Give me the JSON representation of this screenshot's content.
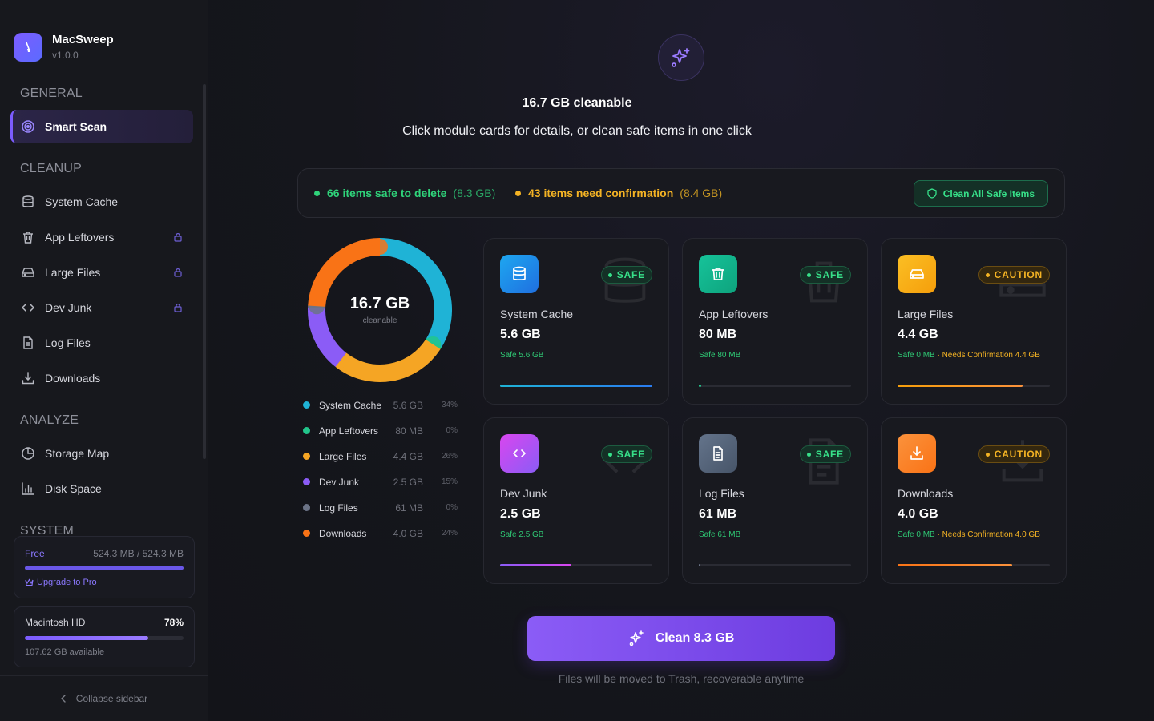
{
  "app": {
    "name": "MacSweep",
    "version": "v1.0.0",
    "accent": "#7c5cff"
  },
  "sidebar": {
    "sections": [
      {
        "label": "GENERAL"
      },
      {
        "label": "CLEANUP"
      },
      {
        "label": "ANALYZE"
      },
      {
        "label": "SYSTEM"
      }
    ],
    "items": [
      {
        "label": "Smart Scan",
        "icon": "radar-icon",
        "active": true,
        "locked": false
      },
      {
        "label": "System Cache",
        "icon": "database-icon",
        "active": false,
        "locked": false
      },
      {
        "label": "App Leftovers",
        "icon": "trash-icon",
        "active": false,
        "locked": true
      },
      {
        "label": "Large Files",
        "icon": "hard-drive-icon",
        "active": false,
        "locked": true
      },
      {
        "label": "Dev Junk",
        "icon": "code-icon",
        "active": false,
        "locked": true
      },
      {
        "label": "Log Files",
        "icon": "file-text-icon",
        "active": false,
        "locked": false
      },
      {
        "label": "Downloads",
        "icon": "download-icon",
        "active": false,
        "locked": false
      },
      {
        "label": "Storage Map",
        "icon": "pie-chart-icon",
        "active": false,
        "locked": false
      },
      {
        "label": "Disk Space",
        "icon": "bar-chart-icon",
        "active": false,
        "locked": false
      }
    ],
    "plan": {
      "label": "Free",
      "usage": "524.3 MB / 524.3 MB",
      "fill": 1.0,
      "upgrade": "Upgrade to Pro"
    },
    "disk": {
      "name": "Macintosh HD",
      "percent": "78%",
      "fill": 0.78,
      "available": "107.62 GB available"
    },
    "collapse": "Collapse sidebar"
  },
  "hero": {
    "title": "16.7 GB  cleanable",
    "subtitle": "Click module cards for details, or clean safe items in one click"
  },
  "summary": {
    "safe": {
      "text": "66 items safe to delete",
      "size": "(8.3 GB)",
      "color": "#2fd37a"
    },
    "warn": {
      "text": "43 items need confirmation",
      "size": "(8.4 GB)",
      "color": "#f4b324"
    },
    "button": "Clean All Safe Items"
  },
  "donut": {
    "value": "16.7 GB",
    "label": "cleanable"
  },
  "legend": [
    {
      "name": "System Cache",
      "size": "5.6 GB",
      "pct": "34%",
      "color": "#1fb3d6"
    },
    {
      "name": "App Leftovers",
      "size": "80 MB",
      "pct": "0%",
      "color": "#22c58b"
    },
    {
      "name": "Large Files",
      "size": "4.4 GB",
      "pct": "26%",
      "color": "#f5a524"
    },
    {
      "name": "Dev Junk",
      "size": "2.5 GB",
      "pct": "15%",
      "color": "#8b5cf6"
    },
    {
      "name": "Log Files",
      "size": "61 MB",
      "pct": "0%",
      "color": "#6b7386"
    },
    {
      "name": "Downloads",
      "size": "4.0 GB",
      "pct": "24%",
      "color": "#f97316"
    }
  ],
  "cards": [
    {
      "name": "System Cache",
      "size": "5.6 GB",
      "badge": "SAFE",
      "status": "safe",
      "icon": "database-icon",
      "grad": [
        "#1ea7f0",
        "#1f6fe0"
      ],
      "note_safe": "Safe 5.6 GB",
      "note_warn": "",
      "progress": 1.0,
      "bar": "linear-gradient(90deg,#1fb3d6,#2a7bf0)"
    },
    {
      "name": "App Leftovers",
      "size": "80 MB",
      "badge": "SAFE",
      "status": "safe",
      "icon": "trash-icon",
      "grad": [
        "#16c39a",
        "#0ea37d"
      ],
      "note_safe": "Safe 80 MB",
      "note_warn": "",
      "progress": 0.015,
      "bar": "#22c58b"
    },
    {
      "name": "Large Files",
      "size": "4.4 GB",
      "badge": "CAUTION",
      "status": "caution",
      "icon": "hard-drive-icon",
      "grad": [
        "#fbbf24",
        "#f59e0b"
      ],
      "note_safe": "Safe 0 MB",
      "note_warn": " · Needs Confirmation 4.4 GB",
      "progress": 0.82,
      "bar": "linear-gradient(90deg,#f59e0b,#fb923c)"
    },
    {
      "name": "Dev Junk",
      "size": "2.5 GB",
      "badge": "SAFE",
      "status": "safe",
      "icon": "code-icon",
      "grad": [
        "#d946ef",
        "#8b5cf6"
      ],
      "note_safe": "Safe 2.5 GB",
      "note_warn": "",
      "progress": 0.47,
      "bar": "linear-gradient(90deg,#8b5cf6,#d946ef)"
    },
    {
      "name": "Log Files",
      "size": "61 MB",
      "badge": "SAFE",
      "status": "safe",
      "icon": "file-text-icon",
      "grad": [
        "#64748b",
        "#475569"
      ],
      "note_safe": "Safe 61 MB",
      "note_warn": "",
      "progress": 0.012,
      "bar": "#6b7386"
    },
    {
      "name": "Downloads",
      "size": "4.0 GB",
      "badge": "CAUTION",
      "status": "caution",
      "icon": "download-icon",
      "grad": [
        "#fb923c",
        "#f97316"
      ],
      "note_safe": "Safe 0 MB",
      "note_warn": " · Needs Confirmation 4.0 GB",
      "progress": 0.75,
      "bar": "linear-gradient(90deg,#f97316,#fb923c)"
    }
  ],
  "action": {
    "label": "Clean 8.3 GB",
    "note": "Files will be moved to Trash, recoverable anytime"
  }
}
